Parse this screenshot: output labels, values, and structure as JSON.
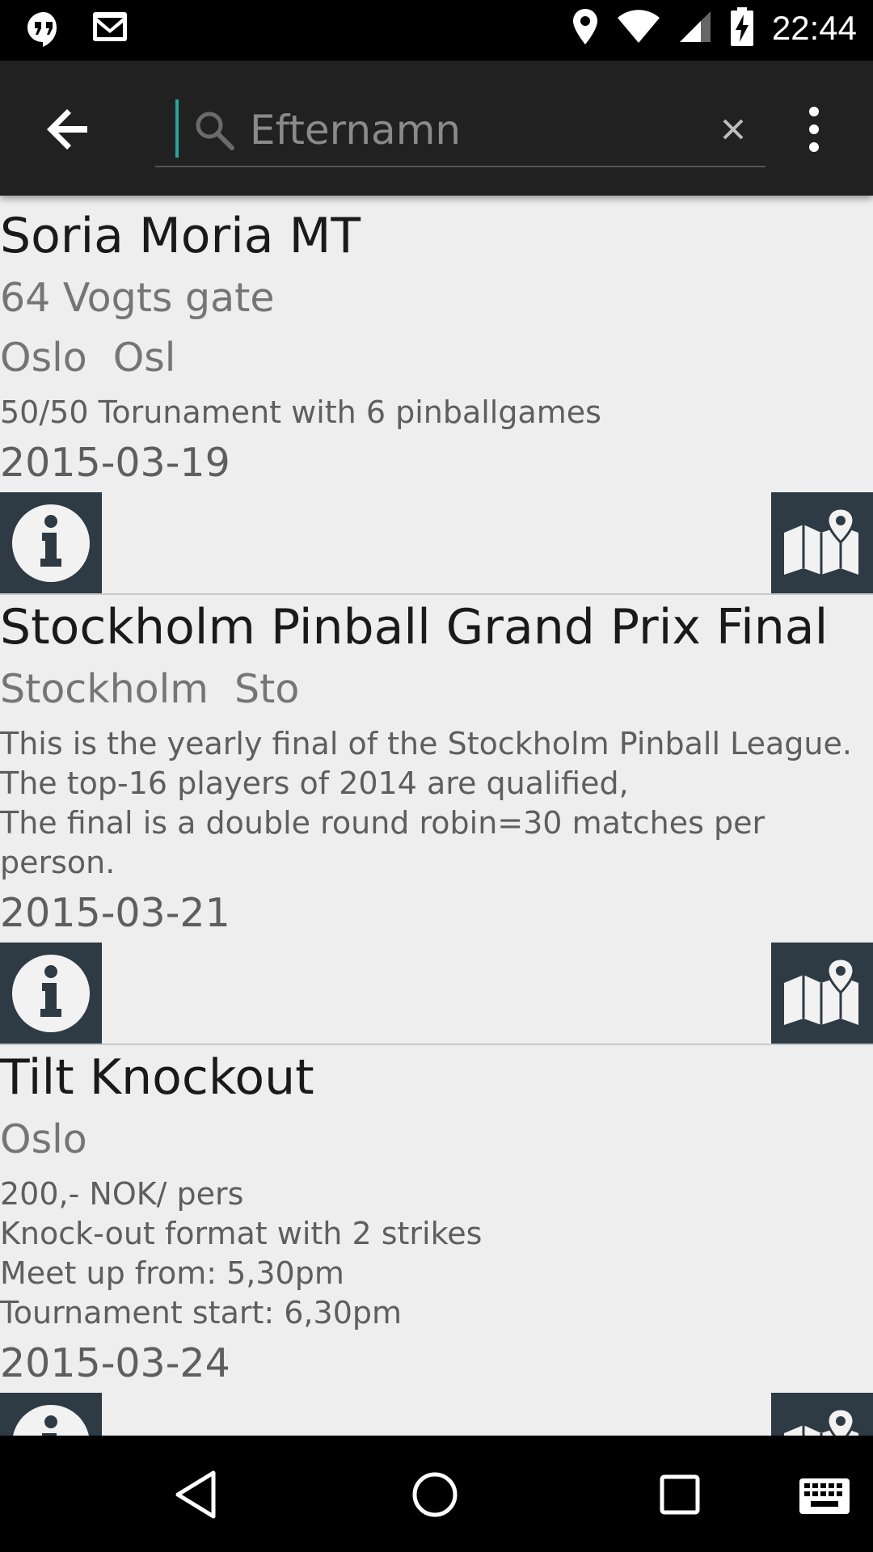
{
  "status_bar": {
    "time": "22:44",
    "icons_left": [
      "hangouts-icon",
      "gmail-icon"
    ],
    "icons_right": [
      "location-icon",
      "wifi-icon",
      "signal-icon",
      "battery-charging-icon"
    ]
  },
  "toolbar": {
    "search_placeholder": "Efternamn",
    "search_value": ""
  },
  "events": [
    {
      "title": "Soria Moria MT",
      "address": "64 Vogts gate",
      "city": "Oslo",
      "city_short": "Osl",
      "description": "50/50 Torunament with 6 pinballgames",
      "date": "2015-03-19"
    },
    {
      "title": "Stockholm Pinball Grand Prix Final",
      "address": "",
      "city": "Stockholm",
      "city_short": "Sto",
      "description": "This is the yearly final of the Stockholm Pinball League.\nThe top-16 players of 2014 are qualified,\nThe final is a double round robin=30 matches per person.",
      "date": "2015-03-21"
    },
    {
      "title": "Tilt Knockout",
      "address": "",
      "city": "Oslo",
      "city_short": "",
      "description": "200,- NOK/ pers\nKnock-out format with 2 strikes\nMeet up from: 5,30pm\nTournament start: 6,30pm",
      "date": "2015-03-24"
    }
  ],
  "colors": {
    "toolbar_bg": "#212121",
    "list_bg": "#eeeeee",
    "button_bg": "#2e3a44",
    "accent_cursor": "#26a69a"
  }
}
